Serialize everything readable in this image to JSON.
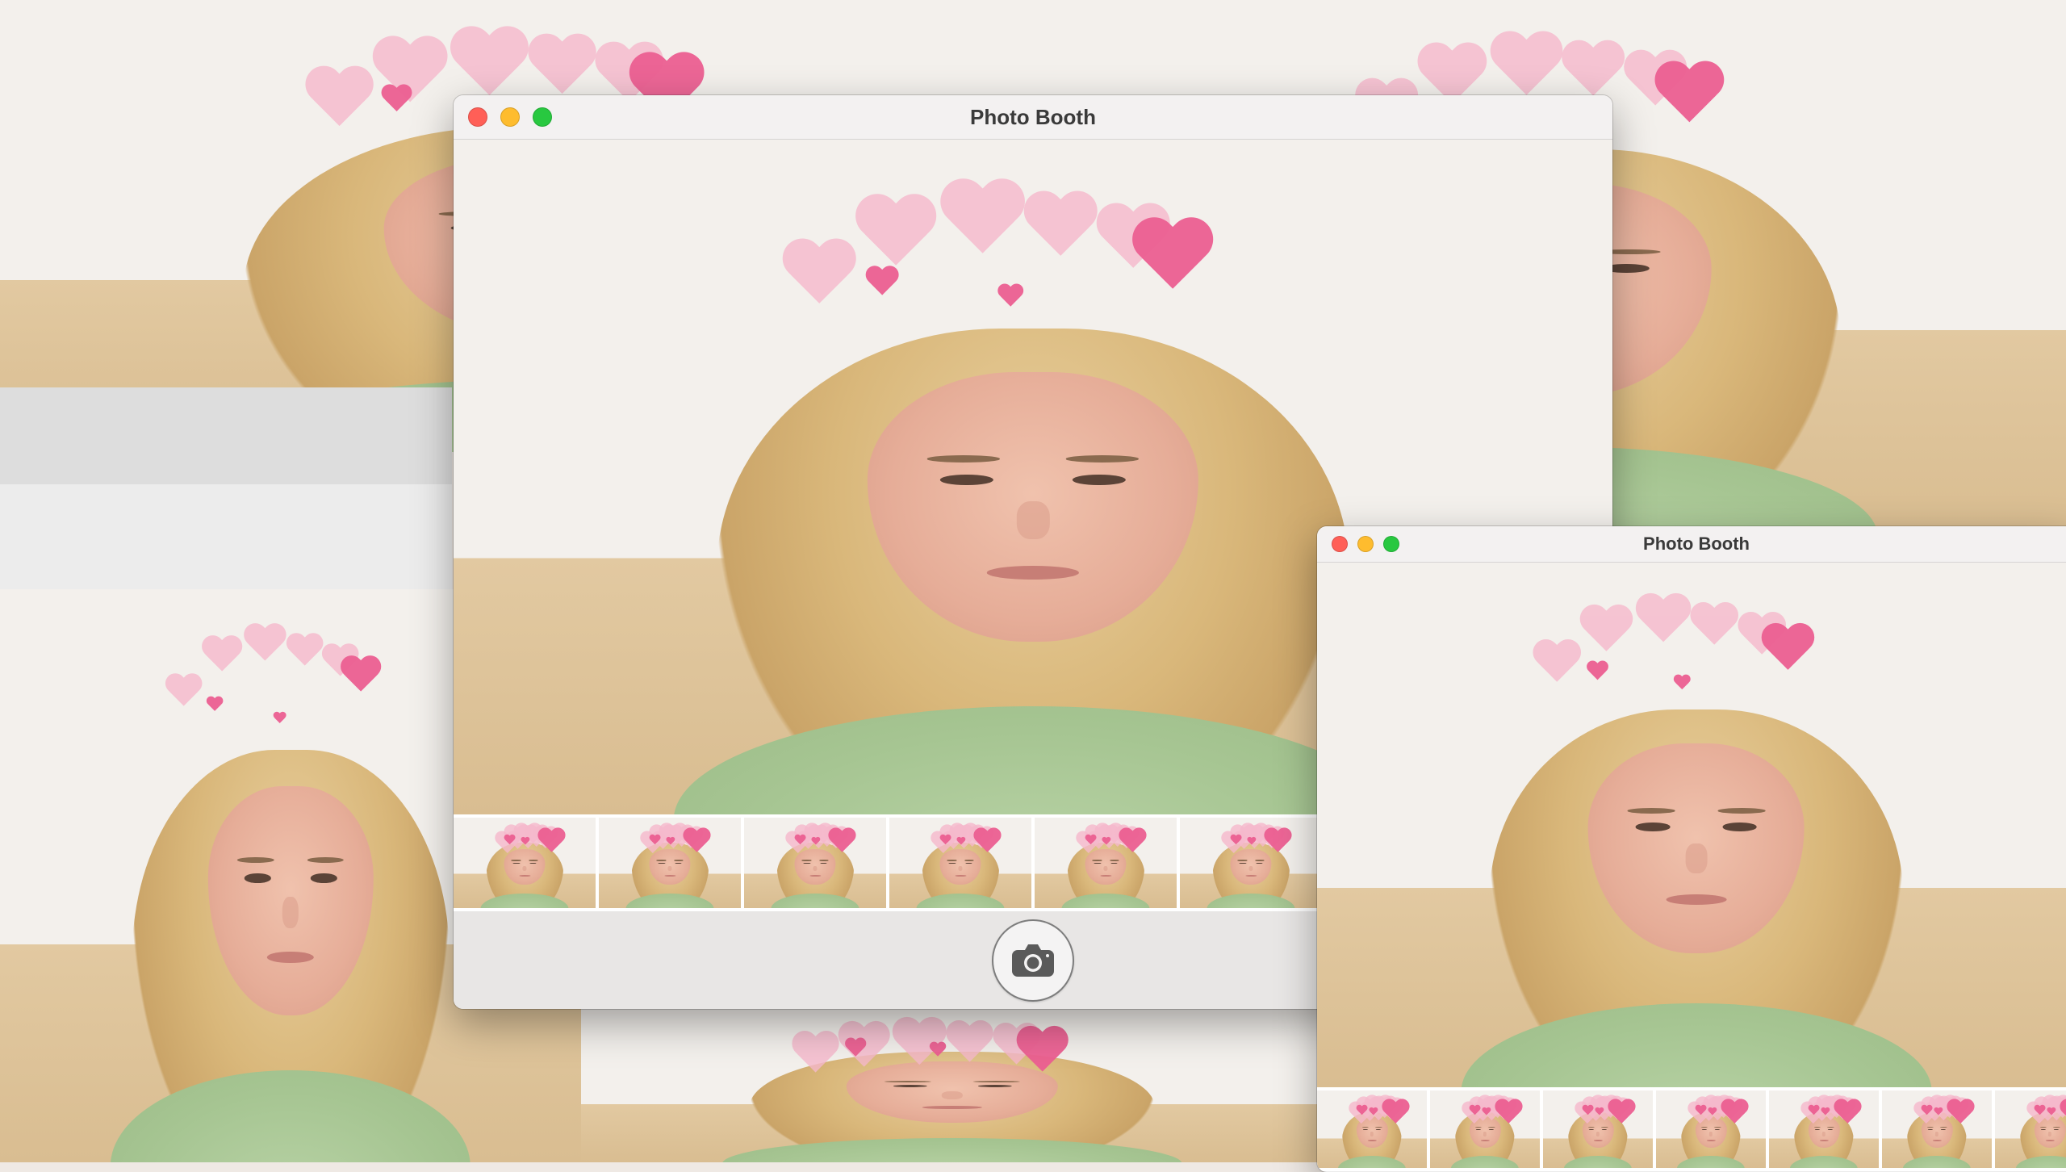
{
  "app": {
    "name": "Photo Booth"
  },
  "windows": [
    {
      "id": "main",
      "title": "Photo Booth",
      "thumbnails": 6,
      "has_shutter": true,
      "shutter_icon": "camera-icon"
    },
    {
      "id": "secondary",
      "title": "Photo Booth",
      "thumbnails": 7,
      "has_shutter": false
    }
  ],
  "background_tiles": 4,
  "effect": "hearts",
  "colors": {
    "close": "#ff5f57",
    "minimize": "#febc2e",
    "zoom": "#28c840",
    "heart_light": "#f6b9cc",
    "heart_dark": "#ec5f92"
  }
}
